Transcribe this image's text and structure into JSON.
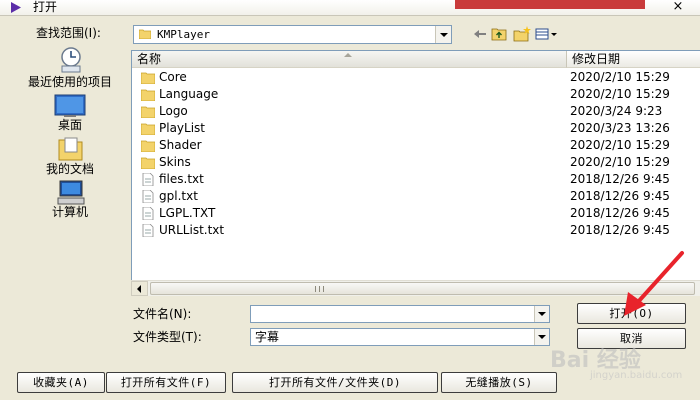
{
  "window": {
    "title": "打开",
    "close_glyph": "×"
  },
  "lookin": {
    "label": "查找范围(I):",
    "value": "KMPlayer"
  },
  "places": [
    {
      "label": "最近使用的项目",
      "icon": "recent-icon"
    },
    {
      "label": "桌面",
      "icon": "desktop-icon"
    },
    {
      "label": "我的文档",
      "icon": "my-documents-icon"
    },
    {
      "label": "计算机",
      "icon": "computer-icon"
    }
  ],
  "columns": {
    "name": "名称",
    "date": "修改日期"
  },
  "files": [
    {
      "name": "Core",
      "date": "2020/2/10 15:29",
      "type": "folder"
    },
    {
      "name": "Language",
      "date": "2020/2/10 15:29",
      "type": "folder"
    },
    {
      "name": "Logo",
      "date": "2020/3/24 9:23",
      "type": "folder"
    },
    {
      "name": "PlayList",
      "date": "2020/3/23 13:26",
      "type": "folder"
    },
    {
      "name": "Shader",
      "date": "2020/2/10 15:29",
      "type": "folder"
    },
    {
      "name": "Skins",
      "date": "2020/2/10 15:29",
      "type": "folder"
    },
    {
      "name": "files.txt",
      "date": "2018/12/26 9:45",
      "type": "file"
    },
    {
      "name": "gpl.txt",
      "date": "2018/12/26 9:45",
      "type": "file"
    },
    {
      "name": "LGPL.TXT",
      "date": "2018/12/26 9:45",
      "type": "file"
    },
    {
      "name": "URLList.txt",
      "date": "2018/12/26 9:45",
      "type": "file"
    }
  ],
  "filename": {
    "label": "文件名(N):",
    "value": ""
  },
  "filetype": {
    "label": "文件类型(T):",
    "value": "字幕"
  },
  "buttons": {
    "open": "打开(O)",
    "cancel": "取消",
    "favorites": "收藏夹(A)",
    "open_all_files": "打开所有文件(F)",
    "open_all_files_folders": "打开所有文件/文件夹(D)",
    "seamless_play": "无缝播放(S)"
  },
  "watermark": {
    "brand": "Bai 经验",
    "site": "jingyan.baidu.com"
  },
  "colors": {
    "annotation_arrow": "#e8232b",
    "accent_blue": "#7f9db9"
  }
}
